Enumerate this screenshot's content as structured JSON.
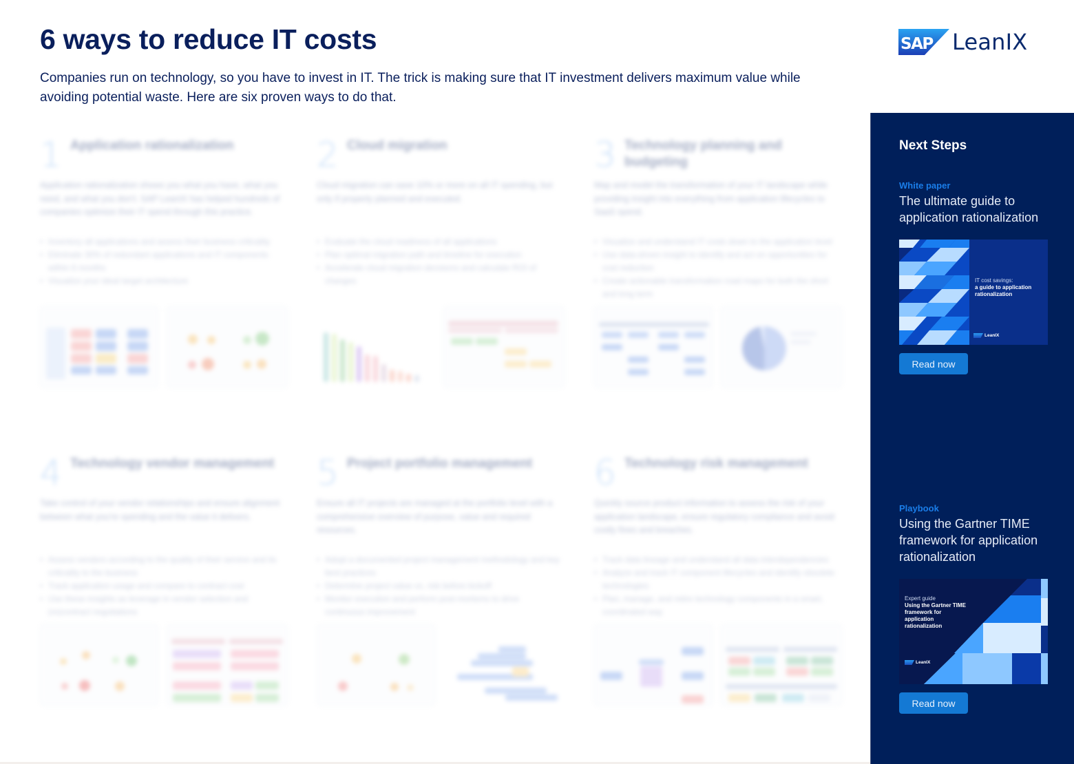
{
  "header": {
    "title": "6 ways to reduce IT costs",
    "intro": "Companies run on technology, so you have to invest in IT. The trick is making sure that IT investment delivers maximum value while avoiding potential waste. Here are six proven ways to do that.",
    "logo": {
      "mark": "SAP",
      "text": "LeanIX"
    }
  },
  "ways": [
    {
      "number": "1",
      "title": "Application rationalization",
      "description": "Application rationalization shows you what you have, what you need, and what you don't. SAP LeanIX has helped hundreds of companies optimize their IT spend through this practice.",
      "bullets": [
        "Inventory all applications and assess their business criticality",
        "Eliminate 30% of redundant applications and IT components within 6 months",
        "Visualize your ideal target architecture"
      ]
    },
    {
      "number": "2",
      "title": "Cloud migration",
      "description": "Cloud migration can save 10% or more on all IT spending, but only if properly planned and executed.",
      "bullets": [
        "Evaluate the cloud readiness of all applications",
        "Plan optimal migration path and timeline for execution",
        "Accelerate cloud migration decisions and calculate ROI of changes"
      ]
    },
    {
      "number": "3",
      "title": "Technology planning and budgeting",
      "description": "Map and model the transformation of your IT landscape while providing insight into everything from application lifecycles to SaaS spend.",
      "bullets": [
        "Visualize and understand IT costs down to the application level",
        "Use data-driven insight to identify and act on opportunities for cost reduction",
        "Create actionable transformation road maps for both the short and long term"
      ]
    },
    {
      "number": "4",
      "title": "Technology vendor management",
      "description": "Take control of your vendor relationships and ensure alignment between what you're spending and the value it delivers.",
      "bullets": [
        "Assess vendors according to the quality of their service and its criticality to the business",
        "Track application usage and compare to contract cost",
        "Use these insights as leverage in vendor selection and (re)contract negotiations"
      ]
    },
    {
      "number": "5",
      "title": "Project portfolio management",
      "description": "Ensure all IT projects are managed at the portfolio level with a comprehensive overview of purpose, value and required resources.",
      "bullets": [
        "Adopt a documented project management methodology and key best practices",
        "Determine project value vs. risk before kickoff",
        "Monitor execution and perform post-mortems to drive continuous improvement"
      ]
    },
    {
      "number": "6",
      "title": "Technology risk management",
      "description": "Quickly source product information to assess the risk of your application landscape, ensure regulatory compliance and avoid costly fines and breaches.",
      "bullets": [
        "Track data lineage and understand all data interdependencies",
        "Analyze and track IT component lifecycles and identify obsolete technologies",
        "Plan, manage, and retire technology components in a smart, coordinated way"
      ]
    }
  ],
  "sidebar": {
    "title": "Next Steps",
    "resources": [
      {
        "type": "White paper",
        "title": "The ultimate guide to application rationalization",
        "cover": {
          "subtitle": "IT cost savings:",
          "title": "a guide to application rationalization",
          "logo": "LeanIX"
        },
        "button": "Read now"
      },
      {
        "type": "Playbook",
        "title": "Using the Gartner TIME framework for application rationalization",
        "cover": {
          "subtitle": "Expert guide",
          "title": "Using the Gartner TIME framework for application rationalization",
          "logo": "LeanIX"
        },
        "button": "Read now"
      }
    ]
  },
  "colors": {
    "navy": "#0a1f5c",
    "sidebar_bg": "#001f5a",
    "accent_blue": "#1a7de8",
    "button_blue": "#1479d4"
  }
}
